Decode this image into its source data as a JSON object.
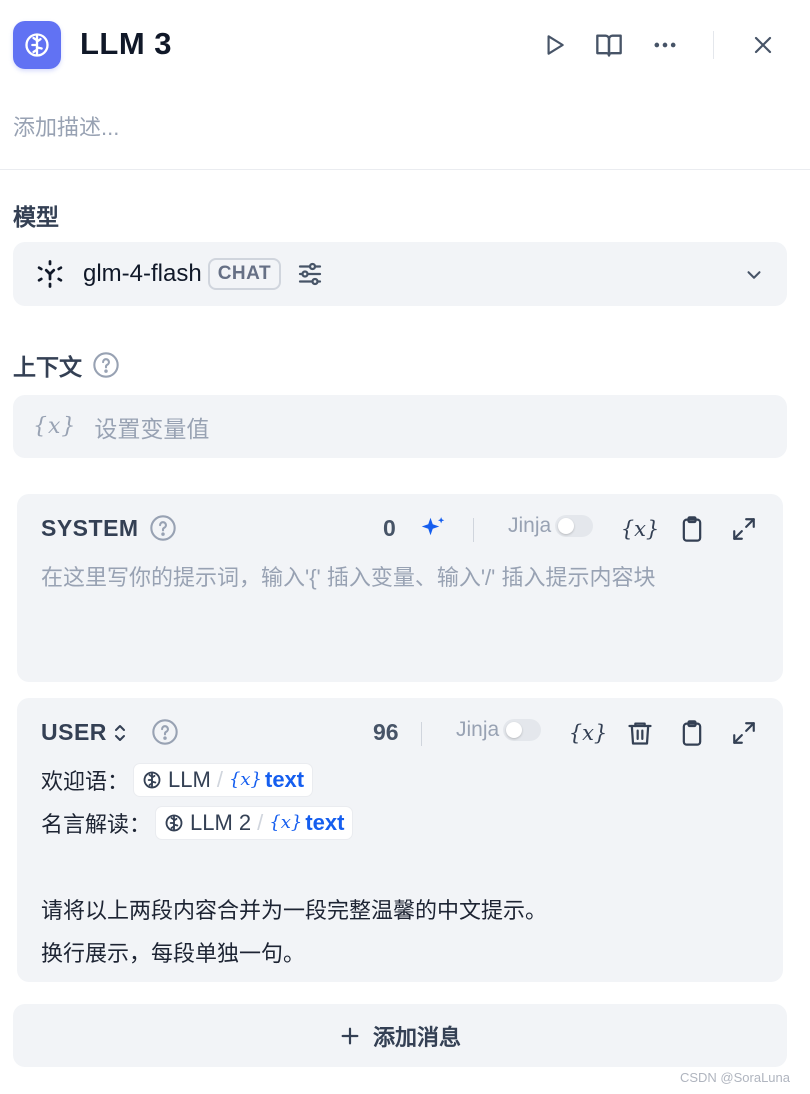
{
  "node": {
    "icon": "llm-brain-icon",
    "title": "LLM 3",
    "description_placeholder": "添加描述...",
    "accent_color": "#6172f3"
  },
  "header_actions": [
    {
      "icon": "play-icon",
      "label": "Run"
    },
    {
      "icon": "book-open-icon",
      "label": "Docs"
    },
    {
      "icon": "more-horizontal-icon",
      "label": "More"
    },
    {
      "icon": "close-icon",
      "label": "Close"
    }
  ],
  "model": {
    "section_label": "模型",
    "name": "glm-4-flash",
    "mode_badge": "CHAT",
    "provider_icon": "zhipu-logo-icon",
    "settings_icon": "sliders-icon",
    "dropdown_icon": "chevron-down-icon"
  },
  "context": {
    "section_label": "上下文",
    "help_icon": "question-circle-icon",
    "var_glyph": "{x}",
    "placeholder": "设置变量值"
  },
  "system_prompt": {
    "role": "SYSTEM",
    "token_count": "0",
    "jinja_label": "Jinja",
    "jinja_enabled": false,
    "var_glyph": "{x}",
    "placeholder": "在这里写你的提示词，输入'{' 插入变量、输入'/' 插入提示内容块",
    "tools": [
      "ai-sparkle-icon",
      "variable-icon",
      "clipboard-icon",
      "expand-icon"
    ]
  },
  "user_prompt": {
    "role": "USER",
    "token_count": "96",
    "jinja_label": "Jinja",
    "jinja_enabled": false,
    "var_glyph": "{x}",
    "tools": [
      "variable-icon",
      "trash-icon",
      "clipboard-icon",
      "expand-icon"
    ],
    "lines": [
      {
        "label": "欢迎语：",
        "node": "LLM",
        "field": "text"
      },
      {
        "label": "名言解读：",
        "node": "LLM 2",
        "field": "text"
      }
    ],
    "text_1": "请将以上两段内容合并为一段完整温馨的中文提示。",
    "text_2": "换行展示，每段单独一句。"
  },
  "add_message": {
    "icon": "plus-icon",
    "label": "添加消息"
  },
  "watermark": "CSDN @SoraLuna"
}
